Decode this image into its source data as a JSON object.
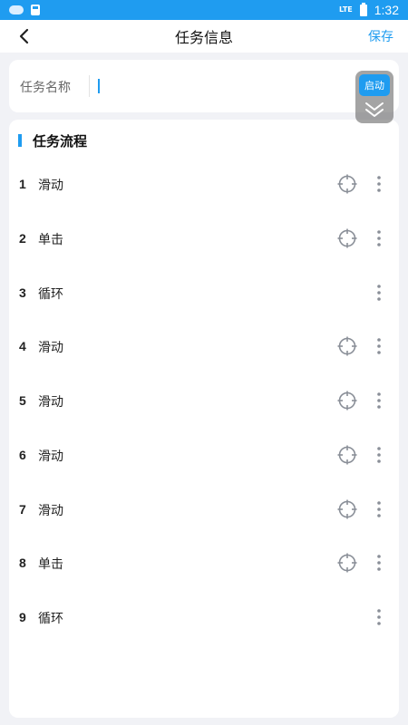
{
  "status_bar": {
    "network": "LTE",
    "time": "1:32"
  },
  "header": {
    "title": "任务信息",
    "save_label": "保存"
  },
  "task_name": {
    "label": "任务名称",
    "value": ""
  },
  "floating": {
    "start_label": "启动"
  },
  "flow": {
    "title": "任务流程",
    "steps": [
      {
        "num": "1",
        "label": "滑动",
        "has_target": true
      },
      {
        "num": "2",
        "label": "单击",
        "has_target": true
      },
      {
        "num": "3",
        "label": "循环",
        "has_target": false
      },
      {
        "num": "4",
        "label": "滑动",
        "has_target": true
      },
      {
        "num": "5",
        "label": "滑动",
        "has_target": true
      },
      {
        "num": "6",
        "label": "滑动",
        "has_target": true
      },
      {
        "num": "7",
        "label": "滑动",
        "has_target": true
      },
      {
        "num": "8",
        "label": "单击",
        "has_target": true
      },
      {
        "num": "9",
        "label": "循环",
        "has_target": false
      }
    ]
  },
  "icons": {
    "target": "crosshair-icon",
    "more": "more-vertical-icon",
    "back": "chevron-left-icon",
    "collapse": "double-chevron-down-icon"
  },
  "colors": {
    "accent": "#1f9cf0",
    "background": "#f1f2f6",
    "card": "#ffffff",
    "icon_gray": "#8a8f98"
  }
}
